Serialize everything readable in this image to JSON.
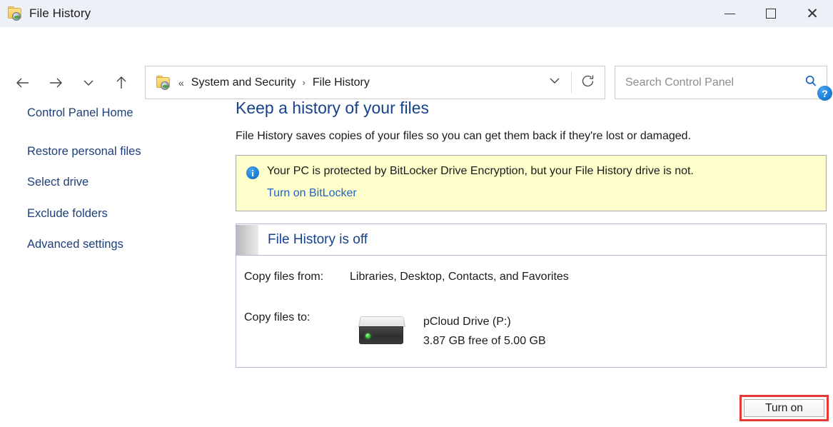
{
  "window": {
    "title": "File History",
    "icon": "folder-history-icon",
    "controls": {
      "minimize": "minimize-icon",
      "maximize": "maximize-icon",
      "close": "close-icon"
    }
  },
  "navigation": {
    "back": "back-arrow-icon",
    "forward": "forward-arrow-icon",
    "recent": "chevron-down-icon",
    "up": "up-arrow-icon",
    "address": {
      "icon": "folder-history-icon",
      "overflow_chevrons": "«",
      "separator": "›",
      "crumbs": [
        "System and Security",
        "File History"
      ],
      "dropdown": "chevron-down-icon",
      "refresh": "refresh-icon"
    },
    "search": {
      "placeholder": "Search Control Panel",
      "value": "",
      "icon": "search-icon"
    }
  },
  "help": {
    "label": "?",
    "name": "help-button"
  },
  "sidebar": {
    "home": "Control Panel Home",
    "items": [
      "Restore personal files",
      "Select drive",
      "Exclude folders",
      "Advanced settings"
    ]
  },
  "main": {
    "title": "Keep a history of your files",
    "description": "File History saves copies of your files so you can get them back if they're lost or damaged.",
    "banner": {
      "icon": "info-icon",
      "text": "Your PC is protected by BitLocker Drive Encryption, but your File History drive is not.",
      "link": "Turn on BitLocker",
      "background": "#ffffcc"
    },
    "status_panel": {
      "status": "File History is off",
      "rows": [
        {
          "label": "Copy files from:",
          "value": "Libraries, Desktop, Contacts, and Favorites"
        },
        {
          "label": "Copy files to:",
          "drive_icon": "external-drive-icon",
          "drive_name": "pCloud Drive (P:)",
          "drive_space": "3.87 GB free of 5.00 GB"
        }
      ]
    }
  },
  "actions": {
    "turn_on": "Turn on",
    "highlight_color": "#e53935"
  },
  "colors": {
    "titlebar": "#eef0f8",
    "heading": "#16428c",
    "link": "#1d3f7a",
    "banner_bg": "#ffffcc",
    "panel_border": "#b8b8d8",
    "accent": "#1e82dc"
  }
}
